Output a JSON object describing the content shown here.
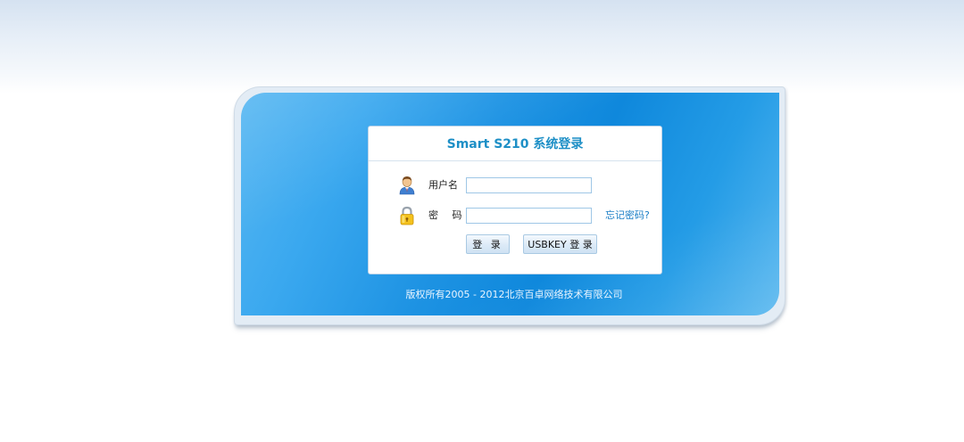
{
  "login": {
    "title": "Smart S210 系统登录",
    "username_label": "用户名",
    "username_value": "",
    "password_label": "密 码",
    "password_value": "",
    "forgot_password": "忘记密码?",
    "login_button": "登 录",
    "usbkey_button": "USBKEY 登 录"
  },
  "footer": {
    "copyright": "版权所有2005 - 2012北京百卓网络技术有限公司"
  },
  "icons": {
    "user": "user-icon",
    "password": "lock-icon"
  },
  "colors": {
    "title": "#1d8fc6",
    "panel_blue": "#1e93e3",
    "link": "#1a7ec6"
  }
}
